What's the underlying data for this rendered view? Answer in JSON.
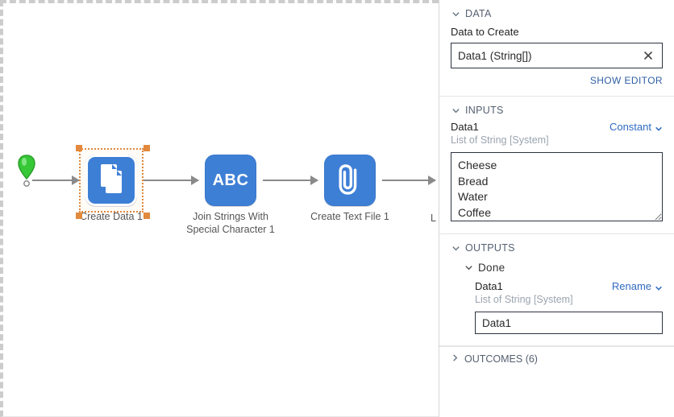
{
  "canvas": {
    "nodes": [
      {
        "label": "Create Data 1"
      },
      {
        "label": "Join Strings With Special Character 1",
        "abc": "ABC"
      },
      {
        "label": "Create Text File 1"
      },
      {
        "label_partial": "L"
      }
    ]
  },
  "panel": {
    "data": {
      "title": "DATA",
      "field_label": "Data to Create",
      "value": "Data1 (String[])",
      "show_editor": "SHOW EDITOR"
    },
    "inputs": {
      "title": "INPUTS",
      "field_label": "Data1",
      "mode_label": "Constant",
      "type_hint": "List of String [System]",
      "textarea_value": "Cheese\nBread\nWater\nCoffee"
    },
    "outputs": {
      "title": "OUTPUTS",
      "done": {
        "title": "Done",
        "field_label": "Data1",
        "action_label": "Rename",
        "type_hint": "List of String [System]",
        "value": "Data1"
      }
    },
    "outcomes": {
      "title": "OUTCOMES (6)"
    }
  }
}
